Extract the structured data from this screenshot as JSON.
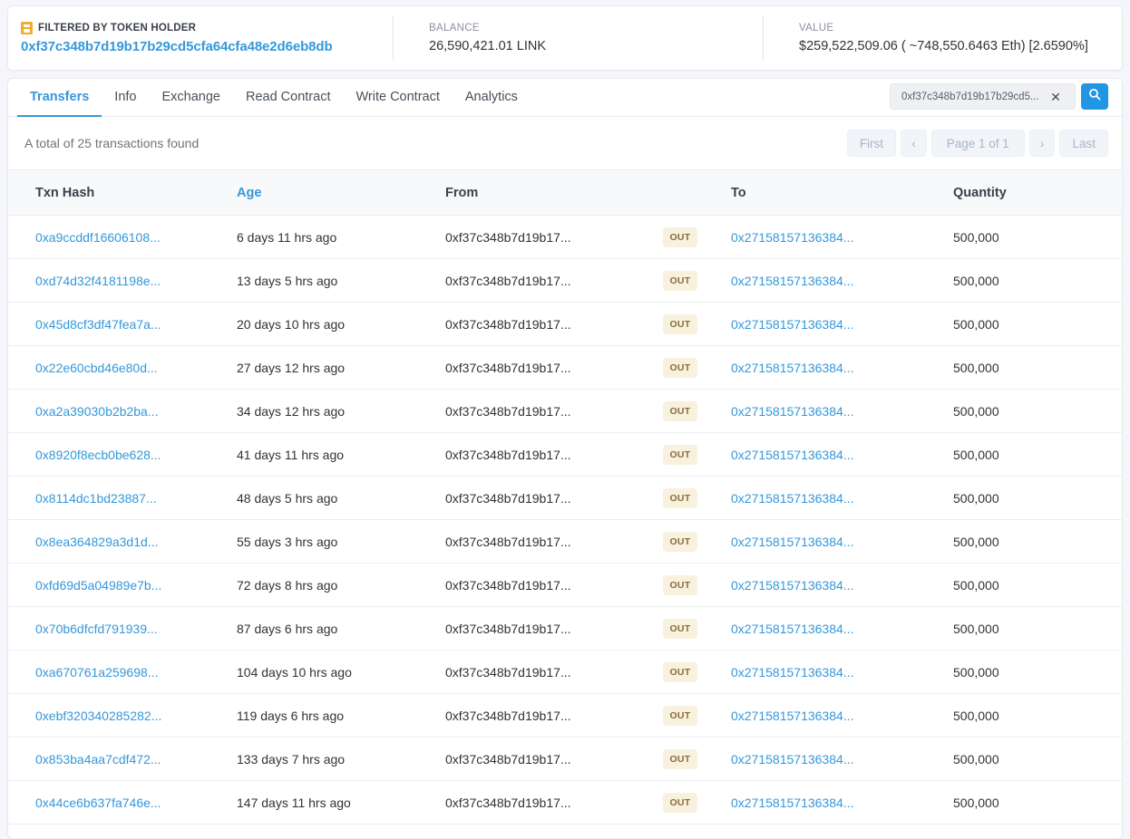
{
  "summary": {
    "filter": {
      "icon": "token-holder-icon",
      "label": "FILTERED BY TOKEN HOLDER",
      "address": "0xf37c348b7d19b17b29cd5cfa64cfa48e2d6eb8db"
    },
    "balance": {
      "label": "BALANCE",
      "value": "26,590,421.01 LINK"
    },
    "value": {
      "label": "VALUE",
      "value": "$259,522,509.06 ( ~748,550.6463 Eth) [2.6590%]"
    }
  },
  "tabs": [
    {
      "label": "Transfers",
      "active": true
    },
    {
      "label": "Info",
      "active": false
    },
    {
      "label": "Exchange",
      "active": false
    },
    {
      "label": "Read Contract",
      "active": false
    },
    {
      "label": "Write Contract",
      "active": false
    },
    {
      "label": "Analytics",
      "active": false
    }
  ],
  "search": {
    "value": "0xf37c348b7d19b17b29cd5...",
    "placeholder": "Search",
    "clear_icon": "close-icon",
    "search_icon": "search-icon"
  },
  "toolbar": {
    "total_text": "A total of 25 transactions found"
  },
  "pagination": {
    "first_label": "First",
    "prev_label": "‹",
    "page_label": "Page 1 of 1",
    "next_label": "›",
    "last_label": "Last"
  },
  "table": {
    "columns": [
      "Txn Hash",
      "Age",
      "From",
      "To",
      "Quantity"
    ],
    "rows": [
      {
        "hash": "0xa9ccddf16606108...",
        "age": "6 days 11 hrs ago",
        "from": "0xf37c348b7d19b17...",
        "direction": "OUT",
        "to": "0x27158157136384...",
        "quantity": "500,000"
      },
      {
        "hash": "0xd74d32f4181198e...",
        "age": "13 days 5 hrs ago",
        "from": "0xf37c348b7d19b17...",
        "direction": "OUT",
        "to": "0x27158157136384...",
        "quantity": "500,000"
      },
      {
        "hash": "0x45d8cf3df47fea7a...",
        "age": "20 days 10 hrs ago",
        "from": "0xf37c348b7d19b17...",
        "direction": "OUT",
        "to": "0x27158157136384...",
        "quantity": "500,000"
      },
      {
        "hash": "0x22e60cbd46e80d...",
        "age": "27 days 12 hrs ago",
        "from": "0xf37c348b7d19b17...",
        "direction": "OUT",
        "to": "0x27158157136384...",
        "quantity": "500,000"
      },
      {
        "hash": "0xa2a39030b2b2ba...",
        "age": "34 days 12 hrs ago",
        "from": "0xf37c348b7d19b17...",
        "direction": "OUT",
        "to": "0x27158157136384...",
        "quantity": "500,000"
      },
      {
        "hash": "0x8920f8ecb0be628...",
        "age": "41 days 11 hrs ago",
        "from": "0xf37c348b7d19b17...",
        "direction": "OUT",
        "to": "0x27158157136384...",
        "quantity": "500,000"
      },
      {
        "hash": "0x8114dc1bd23887...",
        "age": "48 days 5 hrs ago",
        "from": "0xf37c348b7d19b17...",
        "direction": "OUT",
        "to": "0x27158157136384...",
        "quantity": "500,000"
      },
      {
        "hash": "0x8ea364829a3d1d...",
        "age": "55 days 3 hrs ago",
        "from": "0xf37c348b7d19b17...",
        "direction": "OUT",
        "to": "0x27158157136384...",
        "quantity": "500,000"
      },
      {
        "hash": "0xfd69d5a04989e7b...",
        "age": "72 days 8 hrs ago",
        "from": "0xf37c348b7d19b17...",
        "direction": "OUT",
        "to": "0x27158157136384...",
        "quantity": "500,000"
      },
      {
        "hash": "0x70b6dfcfd791939...",
        "age": "87 days 6 hrs ago",
        "from": "0xf37c348b7d19b17...",
        "direction": "OUT",
        "to": "0x27158157136384...",
        "quantity": "500,000"
      },
      {
        "hash": "0xa670761a259698...",
        "age": "104 days 10 hrs ago",
        "from": "0xf37c348b7d19b17...",
        "direction": "OUT",
        "to": "0x27158157136384...",
        "quantity": "500,000"
      },
      {
        "hash": "0xebf320340285282...",
        "age": "119 days 6 hrs ago",
        "from": "0xf37c348b7d19b17...",
        "direction": "OUT",
        "to": "0x27158157136384...",
        "quantity": "500,000"
      },
      {
        "hash": "0x853ba4aa7cdf472...",
        "age": "133 days 7 hrs ago",
        "from": "0xf37c348b7d19b17...",
        "direction": "OUT",
        "to": "0x27158157136384...",
        "quantity": "500,000"
      },
      {
        "hash": "0x44ce6b637fa746e...",
        "age": "147 days 11 hrs ago",
        "from": "0xf37c348b7d19b17...",
        "direction": "OUT",
        "to": "0x27158157136384...",
        "quantity": "500,000"
      }
    ]
  },
  "colors": {
    "accent": "#3498db",
    "search_button": "#2196e3",
    "badge_bg": "#f8f1dd",
    "badge_text": "#8a6d3b",
    "filter_icon": "#f0ad2e",
    "page_bg": "#f5f6fa"
  }
}
